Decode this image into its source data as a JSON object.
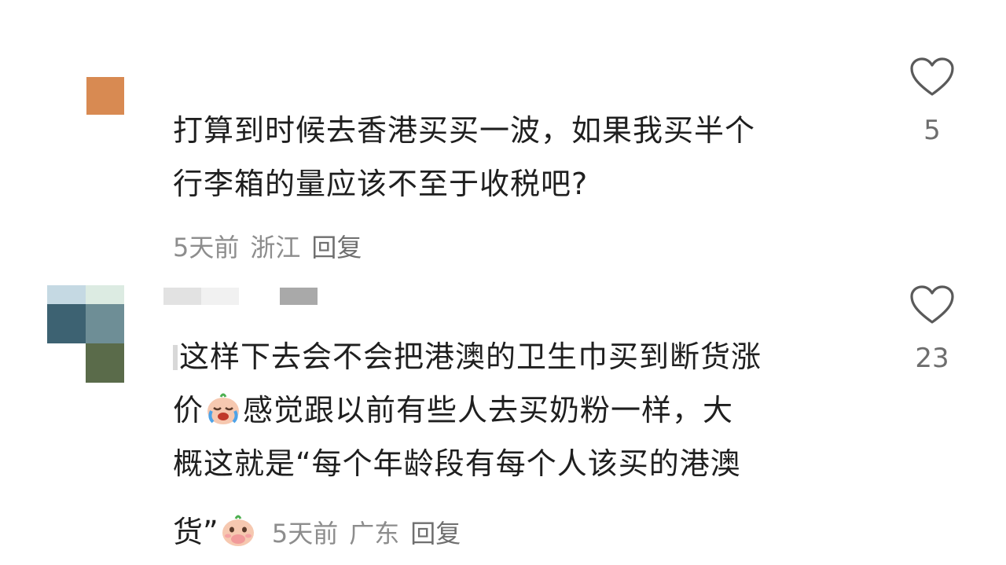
{
  "comments": [
    {
      "text_line1": "打算到时候去香港买买一波，如果我买半个",
      "text_line2": "行李箱的量应该不至于收税吧?",
      "time": "5天前",
      "location": "浙江",
      "reply_label": "回复",
      "like_count": "5",
      "avatar_color": "#d88a52"
    },
    {
      "text_line1": "这样下去会不会把港澳的卫生巾买到断货涨",
      "text_line2a": "价",
      "text_line2b": "感觉跟以前有些人去买奶粉一样，大",
      "text_line3": "概这就是“每个年龄段有每个人该买的港澳",
      "text_line4": "货”",
      "time": "5天前",
      "location": "广东",
      "reply_label": "回复",
      "like_count": "23",
      "emoji_1": "crying-face-emoji",
      "emoji_2": "covering-mouth-emoji"
    }
  ],
  "icons": {
    "like": "heart-outline-icon"
  }
}
